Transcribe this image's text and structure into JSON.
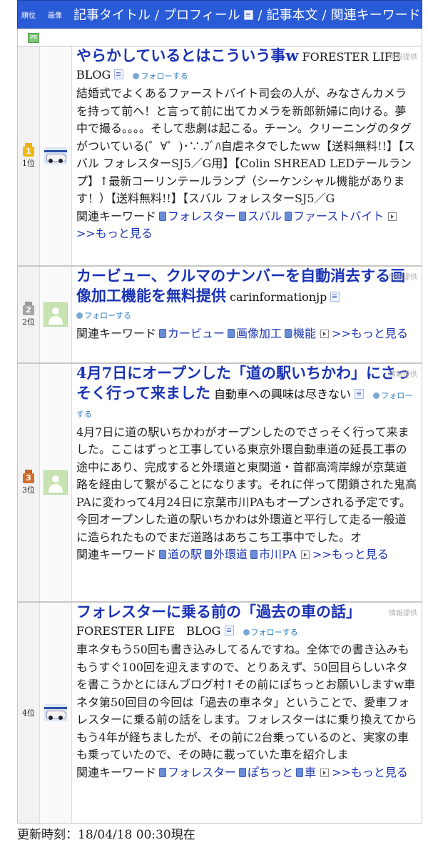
{
  "header": {
    "rank_label": "順位",
    "image_label": "画像",
    "col1": "記事タイトル",
    "col2": "プロフィール",
    "col3": "記事本文",
    "col4": "関連キーワード"
  },
  "pr_label": "PR",
  "colors": {
    "header_bg": "#2a5bd7",
    "title": "#1a33b5"
  },
  "entries": [
    {
      "rank": "1位",
      "medal": "1",
      "title": "やらかしているとはこういう事w",
      "blog": "FORESTER LIFE　BLOG",
      "tag": "情報提供",
      "follow": "フォローする",
      "body": "結婚式でよくあるファーストバイト司会の人が、みなさんカメラを持って前へ！と言って前に出てカメラを新郎新婦に向ける。夢中で撮る。。。。そして悲劇は起こる。チーン。クリーニングのタグがついている(゜∀゜)･∵.ﾌﾞﾊ自虐ネタでしたww【送料無料!!】【スバル フォレスターSJ5／G用】【Colin SHREAD LEDテールランプ】↑最新コーリンテールランプ（シーケンシャル機能があります！）【送料無料!!】【スバル フォレスターSJ5／G",
      "kw_label": "関連キーワード",
      "keywords": [
        "フォレスター",
        "スバル",
        "ファーストバイト"
      ],
      "more": ">>もっと見る"
    },
    {
      "rank": "2位",
      "medal": "2",
      "title": "カービュー、クルマのナンバーを自動消去する画像加工機能を無料提供",
      "blog": "carinformationjp",
      "tag": "情報提供",
      "follow": "フォローする",
      "body": "",
      "kw_label": "関連キーワード",
      "keywords": [
        "カービュー",
        "画像加工",
        "機能"
      ],
      "more": ">>もっと見る"
    },
    {
      "rank": "3位",
      "medal": "3",
      "title": "4月7日にオープンした「道の駅いちかわ」にさっそく行って来ました",
      "blog": "自動車への興味は尽きない",
      "tag": "情報提供",
      "follow": "フォローする",
      "body": "4月7日に道の駅いちかわがオープンしたのでさっそく行って来ました。ここはずっと工事している東京外環自動車道の延長工事の途中にあり、完成すると外環道と東関道・首都高湾岸線が京葉道路を経由して繋がることになります。それに伴って閉鎖された鬼高PAに変わって4月24日に京葉市川PAもオープンされる予定です。今回オープンした道の駅いちかわは外環道と平行して走る一般道に造られたものでまだ道路はあちこち工事中でした。オ",
      "kw_label": "関連キーワード",
      "keywords": [
        "道の駅",
        "外環道",
        "市川PA"
      ],
      "more": ">>もっと見る"
    },
    {
      "rank": "4位",
      "medal": "",
      "title": "フォレスターに乗る前の「過去の車の話」",
      "blog": "FORESTER LIFE　BLOG",
      "tag": "情報提供",
      "follow": "フォローする",
      "body": "車ネタもう50回も書き込みしてるんですね。全体での書き込みももうすぐ100回を迎えますので、とりあえず、50回目らしいネタを書こうかとにほんブログ村↑その前にぽちっとお願いしますw車ネタ第50回目の今回は「過去の車ネタ」ということで、愛車フォレスターに乗る前の話をします。フォレスターはに乗り換えてからもう4年が経ちましたが、その前に2台乗っているのと、実家の車も乗っていたので、その時に載っていた車を紹介しま",
      "kw_label": "関連キーワード",
      "keywords": [
        "フォレスター",
        "ぽちっと",
        "車"
      ],
      "more": ">>もっと見る"
    }
  ],
  "footer": "更新時刻：18/04/18 00:30現在"
}
